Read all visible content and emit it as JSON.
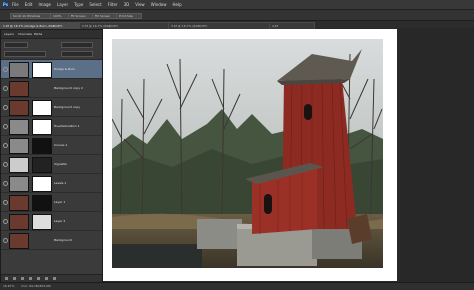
{
  "app": {
    "logo": "Ps"
  },
  "menu": {
    "items": [
      "File",
      "Edit",
      "Image",
      "Layer",
      "Type",
      "Select",
      "Filter",
      "3D",
      "View",
      "Window",
      "Help"
    ]
  },
  "options": {
    "items": [
      "Scroll All Windows",
      "100%",
      "Fit Screen",
      "Fill Screen",
      "Print Size"
    ]
  },
  "tabs": [
    {
      "label": "1.tif @ 16.7% (Dodge & Burn, RGB/16*)",
      "active": true
    },
    {
      "label": "2.tif @ 16.7% (RGB/16*)",
      "active": false
    },
    {
      "label": "3.tif @ 16.7% (RGB/16*)",
      "active": false
    },
    {
      "label": "4.tif",
      "active": false
    }
  ],
  "layers_panel": {
    "tabs": [
      "Layers",
      "Channels",
      "Paths"
    ],
    "layers": [
      {
        "name": "Dodge & Burn",
        "selected": true,
        "thumb": "#7a7a7a",
        "mask": "#ffffff"
      },
      {
        "name": "Background copy 2",
        "selected": false,
        "thumb": "#6b3a2e",
        "mask": ""
      },
      {
        "name": "Background copy",
        "selected": false,
        "thumb": "#6b3a2e",
        "mask": "#ffffff"
      },
      {
        "name": "Hue/Saturation 1",
        "selected": false,
        "thumb": "#8a8a8a",
        "mask": "#ffffff"
      },
      {
        "name": "Curves 1",
        "selected": false,
        "thumb": "#8a8a8a",
        "mask": "#111111"
      },
      {
        "name": "Vignette",
        "selected": false,
        "thumb": "#cccccc",
        "mask": "#222222"
      },
      {
        "name": "Levels 1",
        "selected": false,
        "thumb": "#8a8a8a",
        "mask": "#ffffff"
      },
      {
        "name": "Layer 1",
        "selected": false,
        "thumb": "#6b3a2e",
        "mask": "#111111"
      },
      {
        "name": "Layer 2",
        "selected": false,
        "thumb": "#6b3a2e",
        "mask": "#dddddd"
      },
      {
        "name": "Background",
        "selected": false,
        "thumb": "#6b3a2e",
        "mask": ""
      }
    ]
  },
  "status": {
    "zoom": "16.67%",
    "doc": "Doc: 69.1M/454.0M"
  }
}
